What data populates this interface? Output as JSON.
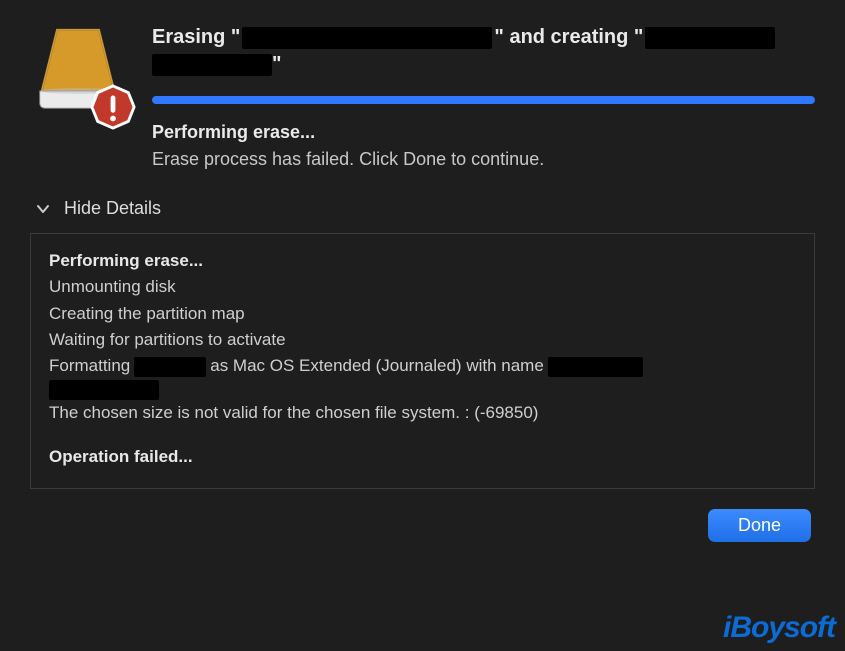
{
  "header": {
    "title_prefix": "Erasing \"",
    "title_mid": "\" and creating \"",
    "title_suffix": "\""
  },
  "status": {
    "title": "Performing erase...",
    "subtitle": "Erase process has failed. Click Done to continue."
  },
  "details": {
    "toggle_label": "Hide Details",
    "heading": "Performing erase...",
    "line1": "Unmounting disk",
    "line2": "Creating the partition map",
    "line3": "Waiting for partitions to activate",
    "line4_a": "Formatting",
    "line4_b": "as Mac OS Extended (Journaled) with name",
    "error": "The chosen size is not valid for the chosen file system. : (-69850)",
    "footer": "Operation failed..."
  },
  "buttons": {
    "done": "Done"
  },
  "watermark": {
    "text": "iBoysoft"
  }
}
